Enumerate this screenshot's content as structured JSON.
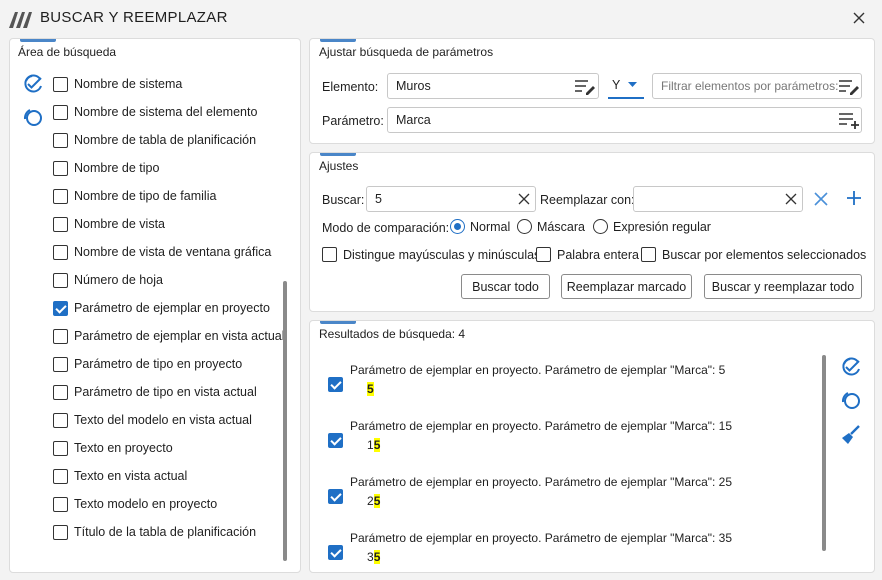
{
  "window": {
    "title": "BUSCAR Y REEMPLAZAR"
  },
  "search_area": {
    "title": "Área de búsqueda",
    "items": [
      {
        "label": "Nombre de sistema",
        "checked": false
      },
      {
        "label": "Nombre de sistema del elemento",
        "checked": false
      },
      {
        "label": "Nombre de tabla de planificación",
        "checked": false
      },
      {
        "label": "Nombre de tipo",
        "checked": false
      },
      {
        "label": "Nombre de tipo de familia",
        "checked": false
      },
      {
        "label": "Nombre de vista",
        "checked": false
      },
      {
        "label": "Nombre de vista de ventana gráfica",
        "checked": false
      },
      {
        "label": "Número de hoja",
        "checked": false
      },
      {
        "label": "Parámetro de ejemplar en proyecto",
        "checked": true
      },
      {
        "label": "Parámetro de ejemplar en vista actual",
        "checked": false
      },
      {
        "label": "Parámetro de tipo en proyecto",
        "checked": false
      },
      {
        "label": "Parámetro de tipo en vista actual",
        "checked": false
      },
      {
        "label": "Texto del modelo en vista actual",
        "checked": false
      },
      {
        "label": "Texto en proyecto",
        "checked": false
      },
      {
        "label": "Texto en vista actual",
        "checked": false
      },
      {
        "label": "Texto modelo en proyecto",
        "checked": false
      },
      {
        "label": "Título de la tabla de planificación",
        "checked": false
      }
    ]
  },
  "params": {
    "title": "Ajustar búsqueda de parámetros",
    "element_label": "Elemento:",
    "element_value": "Muros",
    "logic_value": "Y",
    "filter_placeholder": "Filtrar elementos por parámetros:",
    "param_label": "Parámetro:",
    "param_value": "Marca"
  },
  "settings": {
    "title": "Ajustes",
    "find_label": "Buscar:",
    "find_value": "5",
    "replace_label": "Reemplazar con:",
    "replace_value": "",
    "mode_label": "Modo de comparación:",
    "modes": [
      {
        "label": "Normal",
        "selected": true
      },
      {
        "label": "Máscara",
        "selected": false
      },
      {
        "label": "Expresión regular",
        "selected": false
      }
    ],
    "options": [
      {
        "label": "Distingue mayúsculas y minúsculas",
        "checked": false
      },
      {
        "label": "Palabra entera",
        "checked": false
      },
      {
        "label": "Buscar por elementos seleccionados",
        "checked": false
      }
    ],
    "buttons": {
      "find_all": "Buscar todo",
      "replace_marked": "Reemplazar marcado",
      "find_replace_all": "Buscar y reemplazar todo"
    }
  },
  "results": {
    "title": "Resultados de búsqueda: 4",
    "items": [
      {
        "text": "Parámetro de ejemplar en proyecto. Parámetro de ejemplar \"Marca\": 5",
        "value_pre": "",
        "value_match": "5",
        "checked": true
      },
      {
        "text": "Parámetro de ejemplar en proyecto. Parámetro de ejemplar \"Marca\": 15",
        "value_pre": "1",
        "value_match": "5",
        "checked": true
      },
      {
        "text": "Parámetro de ejemplar en proyecto. Parámetro de ejemplar \"Marca\": 25",
        "value_pre": "2",
        "value_match": "5",
        "checked": true
      },
      {
        "text": "Parámetro de ejemplar en proyecto. Parámetro de ejemplar \"Marca\": 35",
        "value_pre": "3",
        "value_match": "5",
        "checked": true
      }
    ]
  },
  "colors": {
    "accent": "#1f6fc5",
    "highlight": "#ffff00"
  }
}
